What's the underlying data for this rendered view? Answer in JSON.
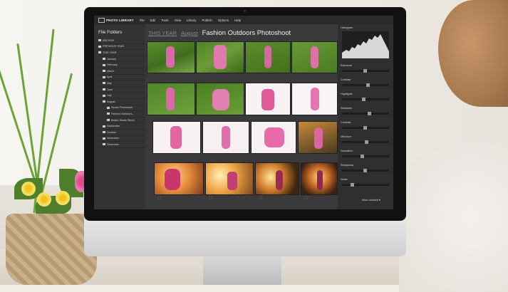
{
  "app": {
    "name": "PHOTO LIBRARY",
    "menu": [
      "File",
      "Edit",
      "Tools",
      "View",
      "Library",
      "Publish",
      "Options",
      "Help"
    ]
  },
  "left_panel": {
    "title": "File Folders",
    "folders": [
      {
        "label": "ARCHIVE",
        "level": 0
      },
      {
        "label": "PREVIOUS YEAR",
        "level": 0
      },
      {
        "label": "THIS YEAR",
        "level": 0
      },
      {
        "label": "January",
        "level": 1
      },
      {
        "label": "February",
        "level": 1
      },
      {
        "label": "March",
        "level": 1
      },
      {
        "label": "April",
        "level": 1
      },
      {
        "label": "May",
        "level": 1
      },
      {
        "label": "June",
        "level": 1
      },
      {
        "label": "July",
        "level": 1
      },
      {
        "label": "August",
        "level": 1
      },
      {
        "label": "Studio Photoshoot",
        "level": 2
      },
      {
        "label": "Fashion Outdoors...",
        "level": 2
      },
      {
        "label": "Beach Studio Shoot",
        "level": 2
      },
      {
        "label": "September",
        "level": 1
      },
      {
        "label": "October",
        "level": 1
      },
      {
        "label": "November",
        "level": 1
      },
      {
        "label": "December",
        "level": 1
      }
    ]
  },
  "breadcrumb": {
    "year": "THIS YEAR",
    "month": "August",
    "title": "Fashion Outdoors Photoshoot"
  },
  "thumb_numbers": [
    "13",
    "14",
    "15",
    "16"
  ],
  "right_panel": {
    "histogram_label": "Histogram",
    "controls": [
      "Exposure",
      "Contrast",
      "Highlights",
      "Shadows",
      "Contrast",
      "Vibrance",
      "Saturation",
      "Sharpness",
      "Noise"
    ],
    "more_controls": "More controls ▾"
  },
  "colors": {
    "screen_bg": "#3a3a3c",
    "panel_bg": "#333335",
    "accent_text": "#f0f0f0"
  }
}
